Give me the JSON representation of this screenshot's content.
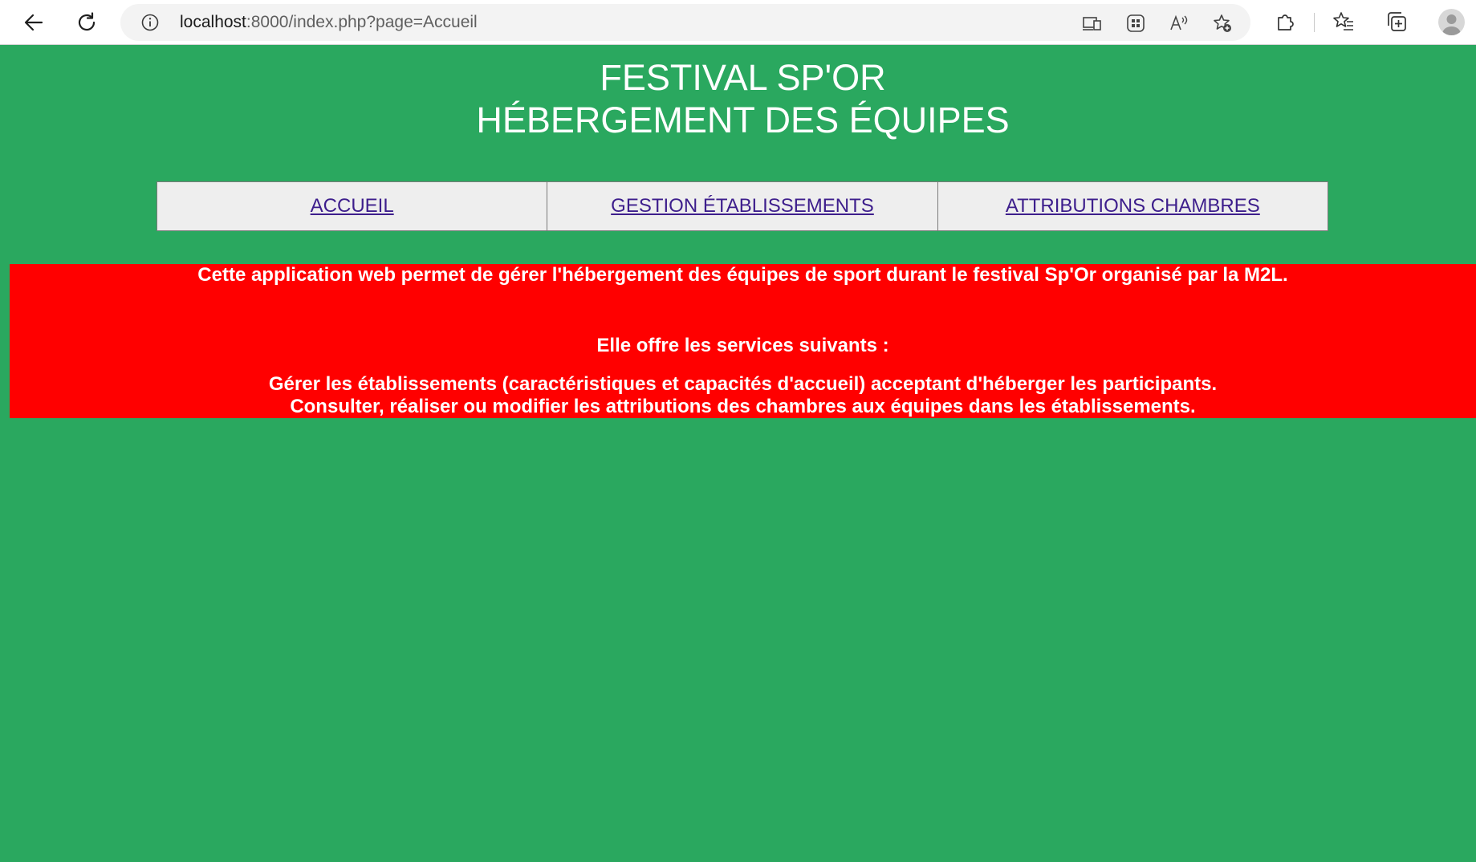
{
  "browser": {
    "url_host": "localhost",
    "url_rest": ":8000/index.php?page=Accueil",
    "icons": [
      "back-icon",
      "reload-icon",
      "info-icon",
      "device-icon",
      "apps-icon",
      "read-aloud-icon",
      "add-favorite-icon",
      "extensions-icon",
      "favorites-icon",
      "collections-icon",
      "profile-icon"
    ]
  },
  "header": {
    "title_line1": "FESTIVAL SP'OR",
    "title_line2": "HÉBERGEMENT DES ÉQUIPES"
  },
  "menu": {
    "items": [
      {
        "label": "ACCUEIL"
      },
      {
        "label": "GESTION ÉTABLISSEMENTS"
      },
      {
        "label": "ATTRIBUTIONS CHAMBRES"
      }
    ]
  },
  "content": {
    "intro": "Cette application web permet de gérer l'hébergement des équipes de sport durant le festival Sp'Or organisé par la M2L.",
    "services_heading": "Elle offre les services suivants :",
    "service_1": "Gérer les établissements (caractéristiques et capacités d'accueil) acceptant d'héberger les participants.",
    "service_2": "Consulter, réaliser ou modifier les attributions des chambres aux équipes dans les établissements."
  },
  "colors": {
    "page_background": "#2aa85f",
    "info_background": "#ff0000",
    "link": "#3d1e8c"
  }
}
